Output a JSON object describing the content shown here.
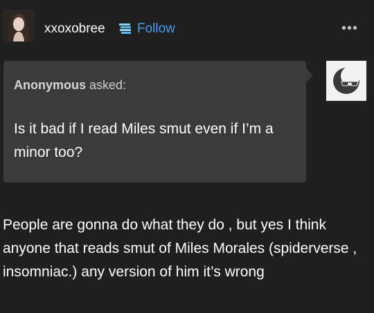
{
  "post": {
    "username": "xxoxobree",
    "follow_label": "Follow",
    "more_label": "•••"
  },
  "ask": {
    "asker_name": "Anonymous",
    "asked_label": "asked:",
    "question": "Is it bad if I read Miles smut even if I’m a minor too?"
  },
  "answer": {
    "text": "People are gonna do what they do , but yes I think anyone that reads smut of Miles Morales (spiderverse , insomniac.) any version of him it’s wrong"
  },
  "icons": {
    "badge": "book-stack-icon",
    "anon": "sunglasses-face-icon"
  },
  "colors": {
    "background": "#1f1f1f",
    "ask_box": "#3b3b3b",
    "follow": "#4a9bf0"
  }
}
